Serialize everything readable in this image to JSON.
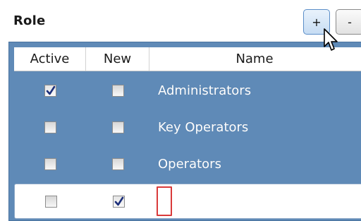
{
  "section": {
    "title": "Role"
  },
  "toolbar": {
    "add_label": "+",
    "remove_label": "-"
  },
  "grid": {
    "columns": {
      "active": "Active",
      "new": "New",
      "name": "Name"
    },
    "rows": [
      {
        "active": true,
        "new": false,
        "name": "Administrators"
      },
      {
        "active": false,
        "new": false,
        "name": "Key Operators"
      },
      {
        "active": false,
        "new": false,
        "name": "Operators"
      },
      {
        "active": false,
        "new": true,
        "name": ""
      }
    ]
  },
  "colors": {
    "grid_background": "#5f8ab7",
    "editor_border": "#d93a3a",
    "checkmark": "#1c2f7a"
  },
  "icons": {
    "checkbox_checked": "checkmark-icon",
    "pointer": "mouse-cursor-icon"
  }
}
